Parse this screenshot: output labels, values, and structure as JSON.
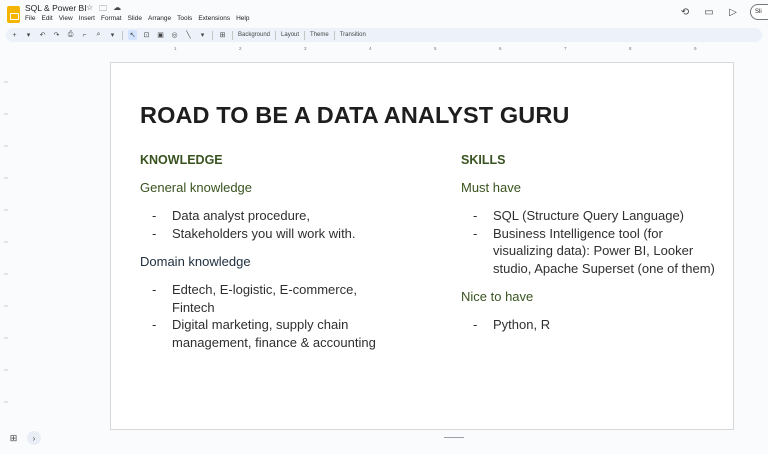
{
  "app": {
    "title": "SQL & Power BI",
    "icons": [
      "star-icon",
      "folder-icon",
      "cloud-icon"
    ]
  },
  "menu": [
    "File",
    "Edit",
    "View",
    "Insert",
    "Format",
    "Slide",
    "Arrange",
    "Tools",
    "Extensions",
    "Help"
  ],
  "top_right": {
    "icons": [
      "history-icon",
      "comment-icon",
      "camera-icon"
    ],
    "slideshow_label": "Sli"
  },
  "toolbar": {
    "background_label": "Background",
    "layout_label": "Layout",
    "theme_label": "Theme",
    "transition_label": "Transition"
  },
  "ruler": {
    "marks": [
      "1",
      "2",
      "3",
      "4",
      "5",
      "6",
      "7",
      "8",
      "9"
    ]
  },
  "slide": {
    "title": "ROAD TO BE A DATA ANALYST GURU",
    "left": {
      "heading": "KNOWLEDGE",
      "groups": [
        {
          "title": "General knowledge",
          "items": [
            "Data analyst procedure,",
            "Stakeholders you will work with."
          ]
        },
        {
          "title": "Domain knowledge",
          "items": [
            "Edtech, E-logistic, E-commerce, Fintech",
            "Digital marketing, supply chain management, finance & accounting"
          ]
        }
      ]
    },
    "right": {
      "heading": "SKILLS",
      "groups": [
        {
          "title": "Must have",
          "items": [
            "SQL (Structure Query Language)",
            "Business Intelligence tool (for visualizing data): Power BI, Looker studio, Apache Superset (one of them)"
          ]
        },
        {
          "title": "Nice to have",
          "items": [
            "Python, R"
          ]
        }
      ]
    }
  },
  "colors": {
    "heading_green": "#38531f",
    "subheading_dark": "#203040",
    "title": "#1e1e1e",
    "toolbar_bg": "#edf2fa"
  }
}
